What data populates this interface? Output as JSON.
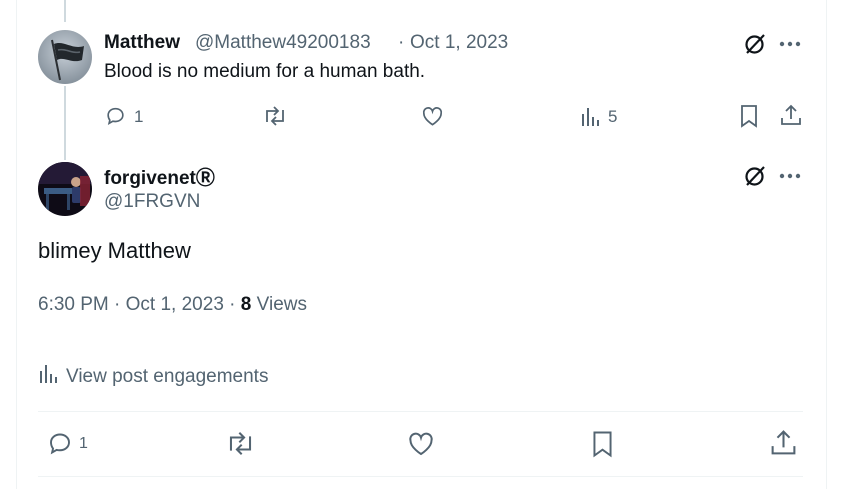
{
  "reply": {
    "author_name": "Matthew",
    "handle": "@Matthew49200183",
    "separator": "·",
    "date": "Oct 1, 2023",
    "text": "Blood is no medium for a human bath.",
    "reply_count": "1",
    "view_count": "5",
    "avatar_icon": "flag-avatar",
    "grok_icon": "grok-icon",
    "more_icon": "more-icon"
  },
  "main_post": {
    "author_name": "forgivenetⓇ",
    "handle": "@1FRGVN",
    "text": "blimey Matthew",
    "time": "6:30 PM",
    "date": "Oct 1, 2023",
    "separator": "·",
    "views_count": "8",
    "views_label": "Views",
    "engagements_label": "View post engagements",
    "reply_count": "1",
    "avatar_icon": "piano-avatar"
  },
  "colors": {
    "text": "#0f1419",
    "muted": "#536471",
    "divider": "#eff3f4",
    "thread_line": "#cfd9de"
  }
}
